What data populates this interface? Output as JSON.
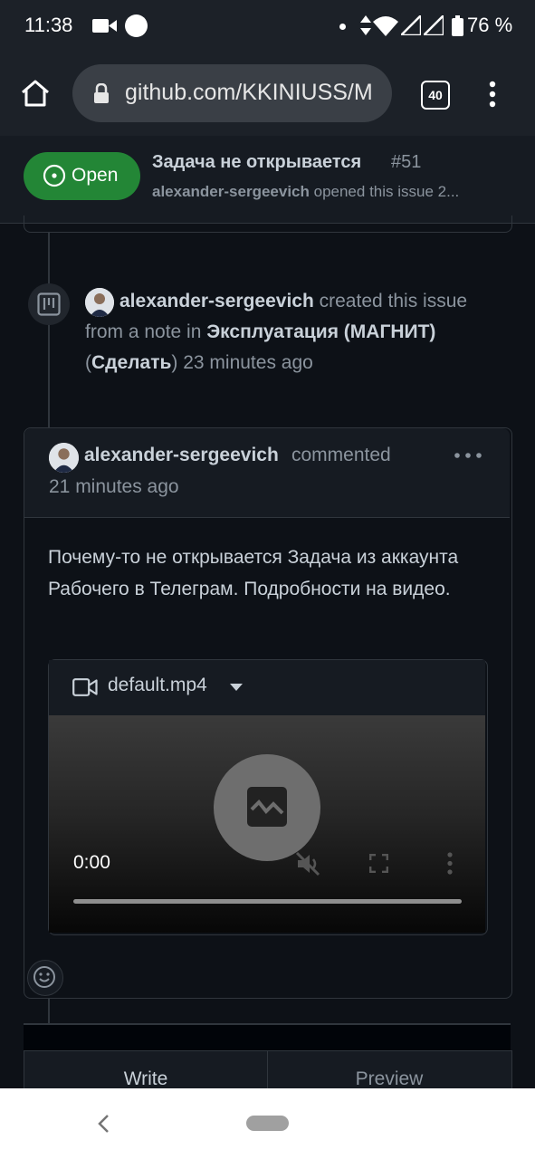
{
  "status_bar": {
    "time": "11:38",
    "battery": "76 %",
    "icons": [
      "video-camera-icon",
      "circle-icon",
      "dot-icon",
      "data-arrows-icon",
      "wifi-icon",
      "signal-icon",
      "battery-icon"
    ]
  },
  "browser": {
    "url": "github.com/KKINIUSS/M",
    "tab_count": "40",
    "icons": [
      "home-icon",
      "lock-icon",
      "tabs-icon",
      "menu-icon"
    ]
  },
  "issue": {
    "state": "Open",
    "title": "Задача не открывается",
    "number": "#51",
    "author": "alexander-sergeevich",
    "subtitle_rest": " opened this issue 2..."
  },
  "timeline_event": {
    "author": "alexander-sergeevich",
    "text1": " created this issue from a note in ",
    "project": "Эксплуатация (МАГНИТ)",
    "paren_open": " (",
    "column": "Сделать",
    "paren_close": ")",
    "time": " 23 minutes ago"
  },
  "comment": {
    "author": "alexander-sergeevich",
    "action": "commented",
    "time": "21 minutes ago",
    "body": "Почему-то не открывается Задача из аккаунта Рабочего в Телеграм. Подробности на видео.",
    "attachment": {
      "file_name": "default.mp4",
      "current_time": "0:00"
    }
  },
  "composer": {
    "tab_write": "Write",
    "tab_preview": "Preview"
  },
  "colors": {
    "background": "#0d1117",
    "open_green": "#238636",
    "border": "#30363d"
  }
}
